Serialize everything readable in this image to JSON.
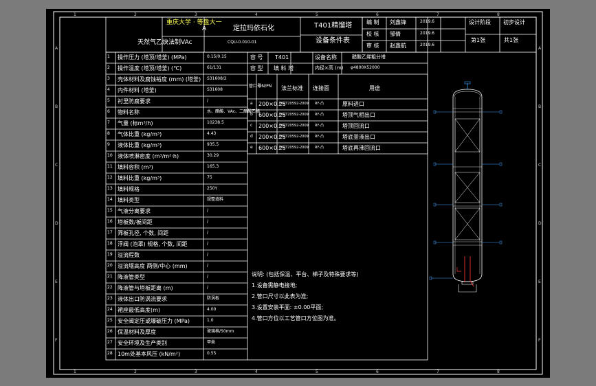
{
  "colors": {
    "background": "#7b7b7b",
    "sheet": "#000000",
    "line": "#ffffff",
    "accent": "#ffff55",
    "vessel": "#ffffff",
    "nozzle": "#3fa0ff",
    "pipe": "#ff3b3b"
  },
  "grid": {
    "top_cols": [
      "1",
      "2",
      "3",
      "4",
      "5",
      "6",
      "7",
      "8"
    ],
    "bottom_cols": [
      "1",
      "2",
      "3",
      "4",
      "5",
      "6",
      "7",
      "8"
    ],
    "rows": [
      "A",
      "B",
      "C",
      "D",
      "E",
      "F"
    ]
  },
  "title_block": {
    "university": "重庆大学 · 等盘大一",
    "letter": "A",
    "project": "天然气乙炔法制VAc",
    "company": "定拉玛依石化",
    "drawing_no": "CQU-0.010-01",
    "equipment": "T401精馏塔",
    "doc_name": "设备条件表",
    "roles": [
      {
        "role": "编 制",
        "name": "刘鑫锋",
        "date": "2019.6"
      },
      {
        "role": "校 核",
        "name": "邹倩",
        "date": "2019.6"
      },
      {
        "role": "审 核",
        "name": "赵鑫航",
        "date": "2019.6"
      }
    ],
    "stage_label": "设计阶段",
    "stage": "初步设计",
    "sheet": "第1张",
    "total": "共1张"
  },
  "params": [
    {
      "no": "1",
      "label": "操作压力 (塔顶/塔釜) (MPa)",
      "value": "0.15/0.15"
    },
    {
      "no": "2",
      "label": "操作温度 (塔顶/塔釜) (℃)",
      "value": "61/131"
    },
    {
      "no": "3",
      "label": "壳体材料及腐蚀裕度 (mm) (塔釜)",
      "value": "S31608/2"
    },
    {
      "no": "4",
      "label": "内件材料 (塔釜)",
      "value": "S31608"
    },
    {
      "no": "5",
      "label": "衬里防腐要求",
      "value": "/"
    },
    {
      "no": "6",
      "label": "物料名称",
      "value": "水、醋酸、VAc、二醋酸乙酯"
    },
    {
      "no": "7",
      "label": "气量 (标m³/h)",
      "value": "10238.5"
    },
    {
      "no": "8",
      "label": "气体比重 (kg/m³)",
      "value": "4.43"
    },
    {
      "no": "9",
      "label": "液体比重 (kg/m³)",
      "value": "935.5"
    },
    {
      "no": "10",
      "label": "液体喷淋密度 (m³/m²·h)",
      "value": "30.29"
    },
    {
      "no": "11",
      "label": "填料容积 (m³)",
      "value": "165.3"
    },
    {
      "no": "12",
      "label": "填料比重 (kg/m³)",
      "value": "75"
    },
    {
      "no": "13",
      "label": "填料规格",
      "value": "250Y"
    },
    {
      "no": "14",
      "label": "填料类型",
      "value": "规整填料"
    },
    {
      "no": "15",
      "label": "气液分离要求",
      "value": "/"
    },
    {
      "no": "16",
      "label": "塔板数/板间距",
      "value": "/"
    },
    {
      "no": "17",
      "label": "筛板孔径, 个数, 间距",
      "value": "/"
    },
    {
      "no": "18",
      "label": "浮阀 (泡罩) 规格, 个数, 间距",
      "value": "/"
    },
    {
      "no": "19",
      "label": "溢流程数",
      "value": "/"
    },
    {
      "no": "20",
      "label": "溢流堰高度 两侧/中心 (mm)",
      "value": "/"
    },
    {
      "no": "21",
      "label": "降液管类型",
      "value": "/"
    },
    {
      "no": "22",
      "label": "降液管与塔板距离 (m)",
      "value": "/"
    },
    {
      "no": "23",
      "label": "液体出口防涡流要求",
      "value": "防涡板"
    },
    {
      "no": "24",
      "label": "裙座最低高度(m)",
      "value": "4.00"
    },
    {
      "no": "25",
      "label": "安全阀定压或爆破压力 (MPa)",
      "value": "1.0"
    },
    {
      "no": "26",
      "label": "保温材料及厚度",
      "value": "玻璃棉/50mm"
    },
    {
      "no": "27",
      "label": "安全环境及生产类别",
      "value": "甲类"
    },
    {
      "no": "28",
      "label": "10m处基本风压 (kN/m²)",
      "value": "0.55"
    }
  ],
  "spec": {
    "row1": {
      "k1": "容 号",
      "v1": "T401",
      "k2": "设备名称",
      "v2": "醋酸乙烯粗分塔"
    },
    "row2": {
      "k1": "容 型",
      "v1": "填 料 塔",
      "k2": "内径×高 (m)",
      "v2": "φ4800X52000"
    }
  },
  "nozzle_headers": {
    "h1": "管口号",
    "h2": "DN/PN",
    "h3": "法兰标准",
    "h4": "连接面",
    "h5": "用途"
  },
  "nozzles": [
    {
      "id": "a",
      "size": "200×0.25",
      "std": "HG/T20592-2009",
      "face": "RF-凸",
      "use": "原料进口"
    },
    {
      "id": "b",
      "size": "600×0.25",
      "std": "HG/T20592-2009",
      "face": "RF-凸",
      "use": "塔顶气相出口"
    },
    {
      "id": "c",
      "size": "200×0.25",
      "std": "HG/T20592-2009",
      "face": "RF-凸",
      "use": "塔顶回流口"
    },
    {
      "id": "d",
      "size": "200×0.25",
      "std": "HG/T20592-2009",
      "face": "RF-凸",
      "use": "塔底釜液出口"
    },
    {
      "id": "e",
      "size": "600×0.25",
      "std": "HG/T20592-2009",
      "face": "RF-凸",
      "use": "塔底再沸回流口"
    }
  ],
  "notes": {
    "title": "说明: (包括保温、平台、梯子及特殊要求等)",
    "items": [
      "1.设备需静电接地;",
      "2.管口尺寸以此表为准;",
      "3.设置安装平面: ±0.00平面;",
      "4.管口方位以工艺管口方位图为准。"
    ]
  }
}
